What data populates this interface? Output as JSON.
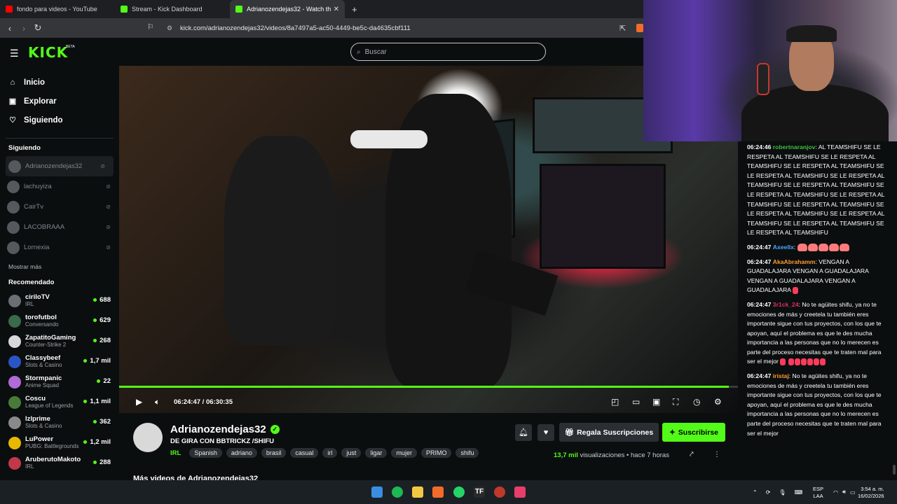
{
  "browser": {
    "tabs": [
      {
        "title": "fondo para videos - YouTube",
        "color": "#ff0000",
        "active": false
      },
      {
        "title": "Stream - Kick Dashboard",
        "color": "#53fc18",
        "active": false
      },
      {
        "title": "Adrianozendejas32 - Watch th",
        "color": "#53fc18",
        "active": true
      }
    ],
    "new_tab": "+",
    "close_tab": "✕",
    "url": "kick.com/adrianozendejas32/videos/8a7497a5-ac50-4449-be5c-da4635cbf111"
  },
  "header": {
    "logo": "KICK",
    "beta": "BETA",
    "search_placeholder": "Buscar"
  },
  "sidebar": {
    "nav": [
      {
        "label": "Inicio",
        "icon": "home-icon"
      },
      {
        "label": "Explorar",
        "icon": "compass-icon"
      },
      {
        "label": "Siguiendo",
        "icon": "heart-icon"
      }
    ],
    "following_title": "Siguiendo",
    "following": [
      "Adrianozendejas32",
      "lachuyiza",
      "CairTv",
      "LACOBRAAA",
      "Lornexia"
    ],
    "show_more": "Mostrar más",
    "recommended_title": "Recomendado",
    "recommended": [
      {
        "name": "ciriloTV",
        "category": "IRL",
        "viewers": "688",
        "avatar": "#6b6f73"
      },
      {
        "name": "torofutbol",
        "category": "Conversando",
        "viewers": "629",
        "avatar": "#3a6a4a"
      },
      {
        "name": "ZapatitoGaming",
        "category": "Counter-Strike 2",
        "viewers": "268",
        "avatar": "#d8d8d8"
      },
      {
        "name": "Classybeef",
        "category": "Slots & Casino",
        "viewers": "1,7 mil",
        "avatar": "#2b54c4"
      },
      {
        "name": "Stormpanic",
        "category": "Anime Squad",
        "viewers": "22",
        "avatar": "#b06bd8"
      },
      {
        "name": "Coscu",
        "category": "League of Legends",
        "viewers": "1,1 mil",
        "avatar": "#4a7a3a"
      },
      {
        "name": "Izlprime",
        "category": "Slots & Casino",
        "viewers": "362",
        "avatar": "#8a8a8a"
      },
      {
        "name": "LuPower",
        "category": "PUBG: Battlegrounds",
        "viewers": "1,2 mil",
        "avatar": "#e6b800"
      },
      {
        "name": "AruberutoMakoto",
        "category": "IRL",
        "viewers": "288",
        "avatar": "#c2384a"
      }
    ]
  },
  "player": {
    "current_time": "06:24:47",
    "separator": "/",
    "duration": "06:30:35",
    "progress": 0.985
  },
  "channel": {
    "name": "Adrianozendejas32",
    "title": "DE GIRA CON BBTRICKZ /SHIFU",
    "category": "IRL",
    "tags": [
      "Spanish",
      "adriano",
      "brasil",
      "casual",
      "irl",
      "just",
      "ligar",
      "mujer",
      "PRIMO",
      "shifu"
    ],
    "gift_label": "Regala Suscripciones",
    "subscribe_label": "Suscribirse",
    "views_count": "13,7 mil",
    "views_word": "visualizaciones",
    "ago": "• hace 7 horas",
    "more_videos": "Más videos de Adrianozendejas32"
  },
  "chat": [
    {
      "ts": "06:24:46",
      "user": "robertnaranjov",
      "user_color": "#3fbf3f",
      "text": ": AL TEAMSHIFU SE LE RESPETA AL TEAMSHIFU SE LE RESPETA AL TEAMSHIFU SE LE RESPETA AL TEAMSHIFU SE LE RESPETA AL TEAMSHIFU SE LE RESPETA AL TEAMSHIFU SE LE RESPETA AL TEAMSHIFU SE LE RESPETA AL TEAMSHIFU SE LE RESPETA AL TEAMSHIFU SE LE RESPETA AL TEAMSHIFU SE LE RESPETA AL TEAMSHIFU SE LE RESPETA AL TEAMSHIFU SE LE RESPETA AL TEAMSHIFU SE LE RESPETA AL TEAMSHIFU"
    },
    {
      "ts": "06:24:47",
      "user": "Axeellx",
      "user_color": "#4aa8ff",
      "text": ":"
    },
    {
      "ts": "06:24:47",
      "user": "AkaAbrahamm",
      "user_color": "#ff9a2e",
      "text": ":  VENGAN A GUADALAJARA VENGAN A GUADALAJARA VENGAN A GUADALAJARA VENGAN A GUADALAJARA"
    },
    {
      "ts": "06:24:47",
      "user": "3r1ck_24",
      "user_color": "#e0305e",
      "text": ": No te agüites shifu, ya no te emociones de más y creetela tu también eres importante sigue con tus proyectos, con los que te apoyan, aquí el problema es que le des mucha importancia a las personas que no lo merecen es parte del proceso necesitas que te traten mal para ser el mejor"
    },
    {
      "ts": "06:24:47",
      "user": "iristaj",
      "user_color": "#ff9a2e",
      "text": ": No te agüites shifu, ya no te emociones de más y creetela tu también eres importante sigue con tus proyectos, con los que te apoyan, aquí el problema es que le des mucha importancia a las personas que no lo merecen es parte del proceso necesitas que te traten mal para ser el mejor"
    }
  ],
  "taskbar": {
    "lang_top": "ESP",
    "lang_bottom": "LAA",
    "time": "3:54 a. m.",
    "date": "16/02/2026"
  }
}
